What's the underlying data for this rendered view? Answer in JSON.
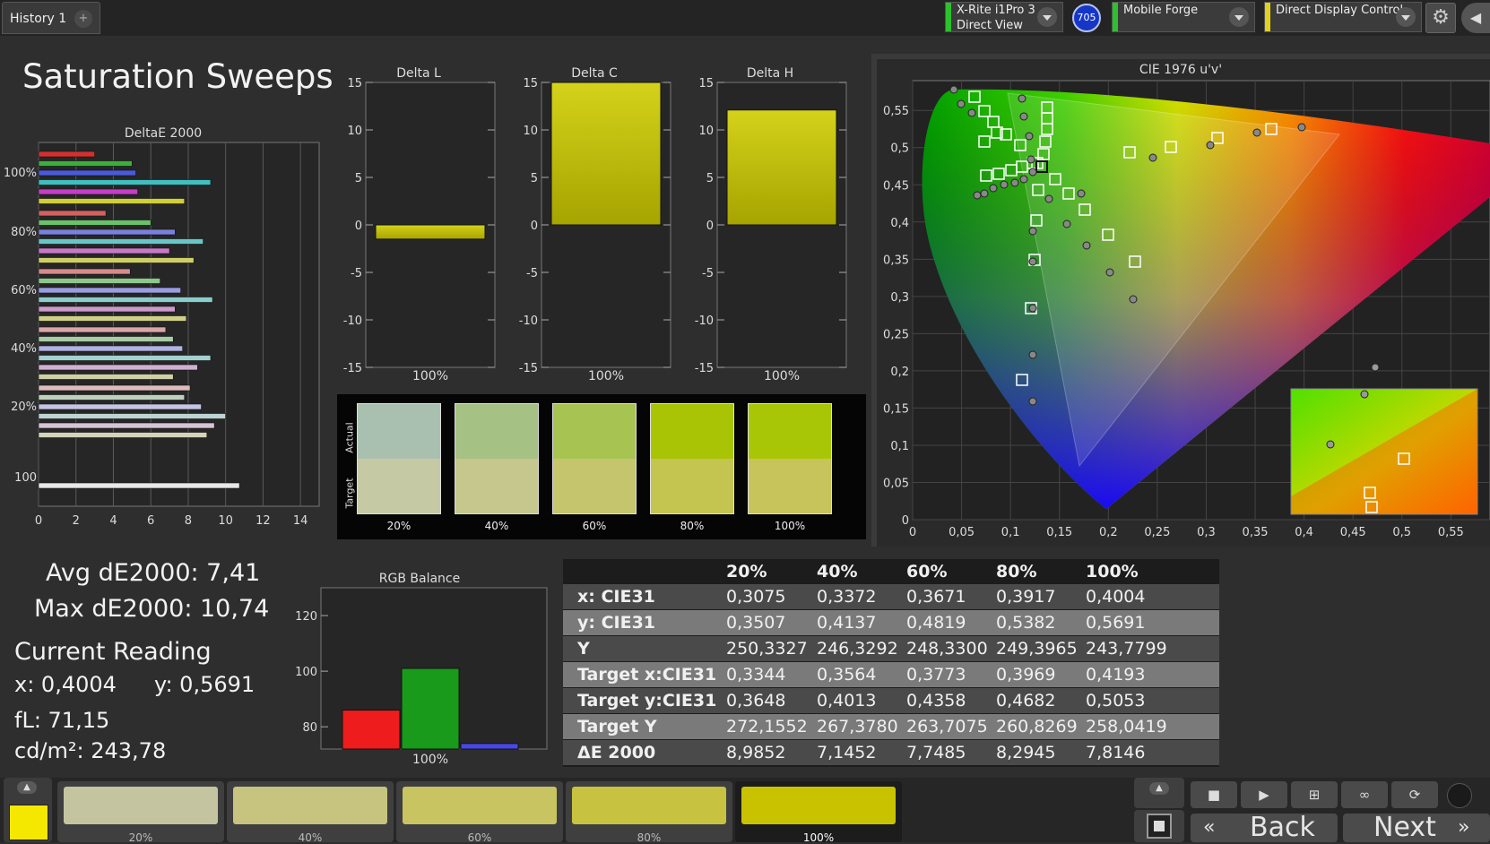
{
  "top": {
    "tab_label": "History 1",
    "tab_plus": "+",
    "device1": {
      "line1": "X-Rite i1Pro 3",
      "line2": "Direct View",
      "color": "#2ec02e"
    },
    "badge": "705",
    "device2": {
      "line1": "Mobile Forge",
      "color": "#2ec02e"
    },
    "device3": {
      "line1": "Direct Display Control",
      "color": "#e0d020"
    },
    "gear_icon": "gear-icon",
    "collapse_icon": "chevron-left-icon"
  },
  "page_title": "Saturation Sweeps",
  "deltae_chart": {
    "title": "DeltaE 2000",
    "x_ticks": [
      "0",
      "2",
      "4",
      "6",
      "8",
      "10",
      "12",
      "14"
    ],
    "y_labels": [
      "100%",
      "80%",
      "60%",
      "40%",
      "20%",
      "100"
    ],
    "xlim": [
      0,
      15
    ],
    "groups": [
      {
        "label": "100%",
        "values": [
          3.0,
          5.0,
          5.2,
          9.2,
          5.3,
          7.8
        ],
        "colors": [
          "#d43030",
          "#3cae3c",
          "#4a5ad8",
          "#3fbfbf",
          "#c83cc8",
          "#cfcf3a"
        ]
      },
      {
        "label": "80%",
        "values": [
          3.6,
          6.0,
          7.3,
          8.8,
          7.0,
          8.3
        ],
        "colors": [
          "#d46060",
          "#6cc06c",
          "#7a80dc",
          "#6ac6c6",
          "#c878c8",
          "#cfcf6a"
        ]
      },
      {
        "label": "60%",
        "values": [
          4.9,
          6.5,
          7.6,
          9.3,
          7.3,
          7.9
        ],
        "colors": [
          "#d88a8a",
          "#8cc88c",
          "#9a9ee0",
          "#8ccccc",
          "#cc9acc",
          "#cfcf8c"
        ]
      },
      {
        "label": "40%",
        "values": [
          6.8,
          7.2,
          7.7,
          9.2,
          8.5,
          7.2
        ],
        "colors": [
          "#dca6a6",
          "#a8cca8",
          "#b0b2e2",
          "#a4d0d0",
          "#d0b0d0",
          "#d0d0a6"
        ]
      },
      {
        "label": "20%",
        "values": [
          8.1,
          7.8,
          8.7,
          10.0,
          9.4,
          9.0
        ],
        "colors": [
          "#dcbcbc",
          "#bcd0bc",
          "#c4c4e4",
          "#bcd4d4",
          "#d6c4d6",
          "#d4d4bc"
        ]
      },
      {
        "label": "100",
        "values": [
          10.74
        ],
        "colors": [
          "#e8e8e8"
        ]
      }
    ]
  },
  "delta_l": {
    "title": "Delta L",
    "value": -1.5,
    "xlabel": "100%"
  },
  "delta_c": {
    "title": "Delta C",
    "value": 15,
    "xlabel": "100%"
  },
  "delta_h": {
    "title": "Delta H",
    "value": 12.1,
    "xlabel": "100%"
  },
  "delta_y_ticks": [
    "15",
    "10",
    "5",
    "0",
    "-5",
    "-10",
    "-15"
  ],
  "swatches": {
    "actual_label": "Actual",
    "target_label": "Target",
    "items": [
      {
        "label": "20%",
        "actual": "#a9c0b0",
        "target": "#c5c9a4"
      },
      {
        "label": "40%",
        "actual": "#a6c184",
        "target": "#c5c78c"
      },
      {
        "label": "60%",
        "actual": "#a7c452",
        "target": "#c4c56c"
      },
      {
        "label": "80%",
        "actual": "#a9c404",
        "target": "#c4c450"
      },
      {
        "label": "100%",
        "actual": "#a8c606",
        "target": "#c6c45a"
      }
    ]
  },
  "cie": {
    "title": "CIE 1976 u'v'",
    "x_ticks": [
      "0",
      "0,05",
      "0,1",
      "0,15",
      "0,2",
      "0,25",
      "0,3",
      "0,35",
      "0,4",
      "0,45",
      "0,5",
      "0,55"
    ],
    "y_ticks": [
      "0",
      "0,05",
      "0,1",
      "0,15",
      "0,2",
      "0,25",
      "0,3",
      "0,35",
      "0,4",
      "0,45",
      "0,5",
      "0,55"
    ]
  },
  "stats": {
    "avg": "Avg dE2000: 7,41",
    "max": "Max dE2000: 10,74",
    "current_reading": "Current Reading",
    "x": "x: 0,4004",
    "y": "y: 0,5691",
    "fl": "fL: 71,15",
    "cdm2": "cd/m²: 243,78"
  },
  "rgb_balance": {
    "title": "RGB Balance",
    "y_ticks": [
      "120",
      "100",
      "80"
    ],
    "xlabel": "100%",
    "ylim": [
      72,
      130
    ],
    "values": {
      "red": 86,
      "green": 101,
      "blue": 74
    }
  },
  "table": {
    "headers": [
      "",
      "20%",
      "40%",
      "60%",
      "80%",
      "100%"
    ],
    "rows": [
      {
        "label": "x: CIE31",
        "values": [
          "0,3075",
          "0,3372",
          "0,3671",
          "0,3917",
          "0,4004"
        ]
      },
      {
        "label": "y: CIE31",
        "values": [
          "0,3507",
          "0,4137",
          "0,4819",
          "0,5382",
          "0,5691"
        ]
      },
      {
        "label": "Y",
        "values": [
          "250,3327",
          "246,3292",
          "248,3300",
          "249,3965",
          "243,7799"
        ]
      },
      {
        "label": "Target x:CIE31",
        "values": [
          "0,3344",
          "0,3564",
          "0,3773",
          "0,3969",
          "0,4193"
        ]
      },
      {
        "label": "Target y:CIE31",
        "values": [
          "0,3648",
          "0,4013",
          "0,4358",
          "0,4682",
          "0,5053"
        ]
      },
      {
        "label": "Target Y",
        "values": [
          "272,1552",
          "267,3780",
          "263,7075",
          "260,8269",
          "258,0419"
        ]
      },
      {
        "label": "ΔE 2000",
        "values": [
          "8,9852",
          "7,1452",
          "7,7485",
          "8,2945",
          "7,8146"
        ]
      }
    ]
  },
  "bottom": {
    "current_color": "#f4e800",
    "patches": [
      {
        "label": "20%",
        "color": "#c4c4a0"
      },
      {
        "label": "40%",
        "color": "#c6c47e"
      },
      {
        "label": "60%",
        "color": "#c8c462"
      },
      {
        "label": "80%",
        "color": "#c7c240"
      },
      {
        "label": "100%",
        "color": "#c8c200"
      }
    ],
    "back_label": "Back",
    "next_label": "Next"
  }
}
